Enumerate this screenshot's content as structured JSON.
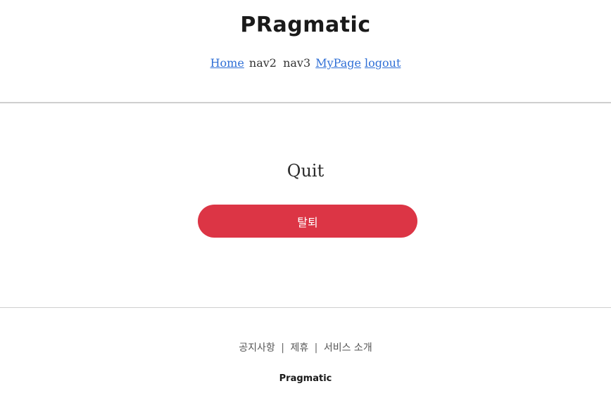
{
  "header": {
    "brand": "PRagmatic",
    "nav": {
      "home": "Home",
      "nav2": "nav2",
      "nav3": "nav3",
      "mypage": "MyPage",
      "logout": "logout"
    }
  },
  "main": {
    "title": "Quit",
    "button_label": "탈퇴"
  },
  "footer": {
    "links": {
      "notice": "공지사항",
      "partnership": "제휴",
      "about": "서비스 소개",
      "separator": "|"
    },
    "brand": "Pragmatic"
  },
  "colors": {
    "accent_link": "#2f6fd6",
    "danger_button": "#dc3545",
    "divider": "#cfcfcf"
  }
}
